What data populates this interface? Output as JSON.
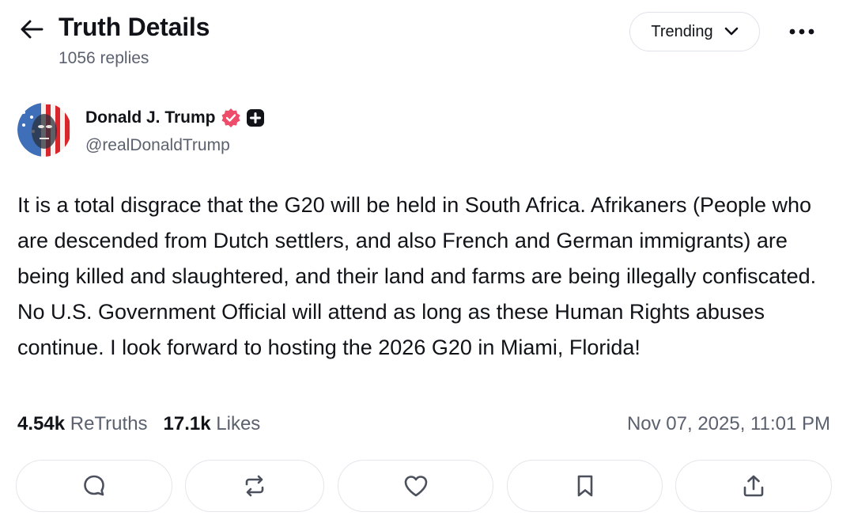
{
  "header": {
    "title": "Truth Details",
    "reply_count": "1056 replies",
    "sort_label": "Trending"
  },
  "post": {
    "author_name": "Donald J. Trump",
    "handle": "@realDonaldTrump",
    "text": "It is a total disgrace that the G20 will be held in South Africa. Afrikaners (People who are descended from Dutch settlers, and also French and German immigrants) are being killed and slaughtered, and their land and farms are being illegally confiscated. No U.S. Government Official will attend as long as these Human Rights abuses continue. I look forward to hosting the 2026 G20 in Miami, Florida!",
    "retruths_count": "4.54k",
    "retruths_label": "ReTruths",
    "likes_count": "17.1k",
    "likes_label": "Likes",
    "timestamp": "Nov 07, 2025, 11:01 PM"
  },
  "colors": {
    "verified_badge": "#ee4c6b",
    "muted_text": "#5b616e",
    "border": "#e3e6eb"
  },
  "icons": {
    "back": "arrow-left-icon",
    "sort": "chevron-down-icon",
    "more": "more-dots-icon",
    "verified": "verified-badge-icon",
    "plus": "plus-badge-icon",
    "reply": "comment-icon",
    "retruth": "repost-icon",
    "like": "heart-icon",
    "bookmark": "bookmark-icon",
    "share": "share-icon"
  }
}
